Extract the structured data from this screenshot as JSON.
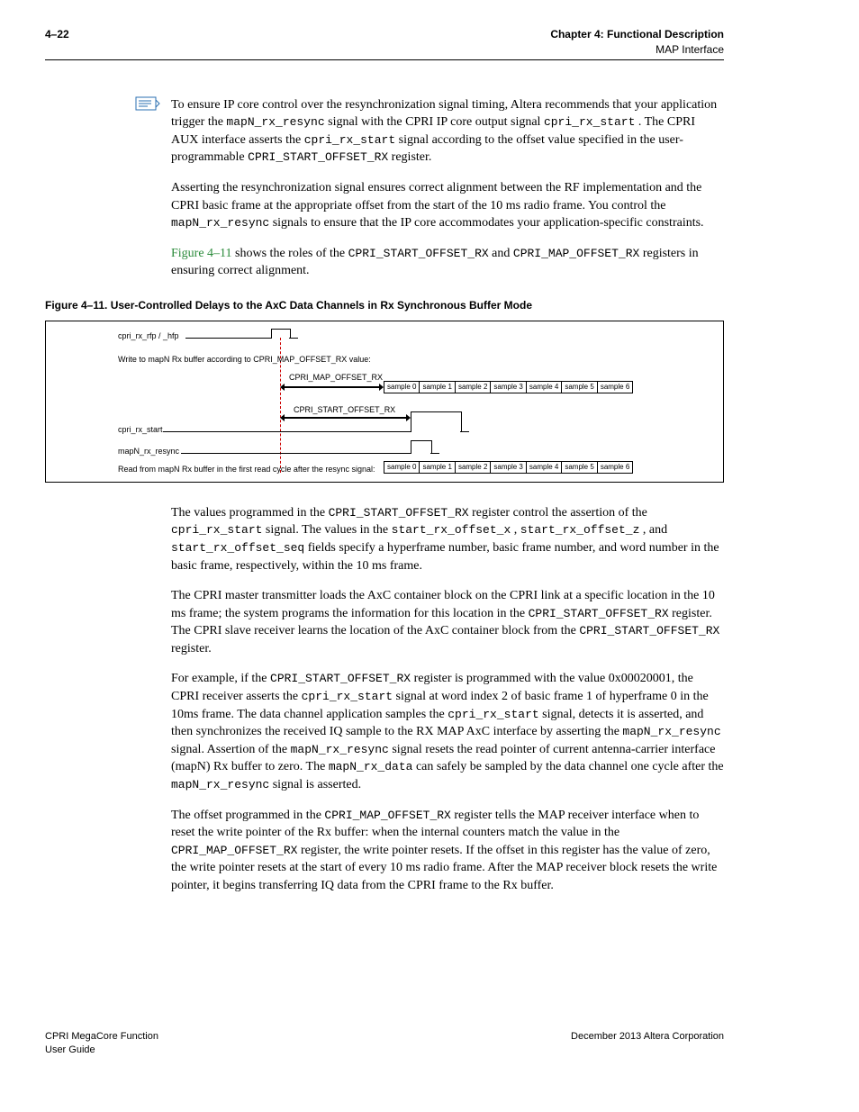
{
  "header": {
    "page": "4–22",
    "chapter": "Chapter 4: Functional Description",
    "section": "MAP Interface"
  },
  "note": {
    "text": "To ensure IP core control over the resynchronization signal timing, Altera recommends that your application trigger the ",
    "mono1": "mapN_rx_resync",
    "text2": " signal with the CPRI IP core output signal ",
    "mono2": "cpri_rx_start",
    "text3": ". The CPRI AUX interface asserts the ",
    "mono3": "cpri_rx_start",
    "text4": " signal according to the offset value specified in the user-programmable ",
    "mono4": "CPRI_START_OFFSET_RX",
    "text5": " register."
  },
  "p2": {
    "t1": "Asserting the resynchronization signal ensures correct alignment between the RF implementation and the CPRI basic frame at the appropriate offset from the start of the 10 ms radio frame. You control the ",
    "m1": "mapN_rx_resync",
    "t2": " signals to ensure that the IP core accommodates your application-specific constraints."
  },
  "p3": {
    "link": "Figure 4–11",
    "t1": " shows the roles of the ",
    "m1": "CPRI_START_OFFSET_RX",
    "t2": " and ",
    "m2": "CPRI_MAP_OFFSET_RX",
    "t3": " registers in ensuring correct alignment."
  },
  "caption": "Figure 4–11.  User-Controlled Delays to the AxC Data Channels in Rx Synchronous Buffer Mode",
  "fig": {
    "l1": "cpri_rx_rfp / _hfp",
    "l2": "Write to mapN Rx buffer according to CPRI_MAP_OFFSET_RX value:",
    "l3": "CPRI_MAP_OFFSET_RX",
    "l4": "CPRI_START_OFFSET_RX",
    "l5": "cpri_rx_start",
    "l6": "mapN_rx_resync",
    "l7": "Read from mapN Rx buffer in the first read cycle after the resync signal:",
    "s0": "sample 0",
    "s1": "sample 1",
    "s2": "sample 2",
    "s3": "sample 3",
    "s4": "sample 4",
    "s5": "sample 5",
    "s6": "sample 6"
  },
  "p4": {
    "t1": "The values programmed in the ",
    "m1": "CPRI_START_OFFSET_RX",
    "t2": " register control the assertion of the ",
    "m2": "cpri_rx_start",
    "t3": " signal. The values in the ",
    "m3": "start_rx_offset_x",
    "t4": ", ",
    "m4": "start_rx_offset_z",
    "t5": ", and ",
    "m5": "start_rx_offset_seq",
    "t6": " fields specify a hyperframe number, basic frame number, and word number in the basic frame, respectively, within the 10 ms frame."
  },
  "p5": {
    "t1": "The CPRI master transmitter loads the AxC container block on the CPRI link at a specific location in the 10 ms frame; the system programs the information for this location in the ",
    "m1": "CPRI_START_OFFSET_RX",
    "t2": " register. The CPRI slave receiver learns the location of the AxC container block from the ",
    "m2": "CPRI_START_OFFSET_RX",
    "t3": " register."
  },
  "p6": {
    "t1": "For example, if the ",
    "m1": "CPRI_START_OFFSET_RX",
    "t2": " register is programmed with the value 0x00020001, the CPRI receiver asserts the ",
    "m2": "cpri_rx_start",
    "t3": " signal at word index 2 of basic frame 1 of hyperframe 0 in the 10ms frame. The data channel application samples the ",
    "m3": "cpri_rx_start",
    "t4": " signal, detects it is asserted, and then synchronizes the received IQ sample to the RX MAP AxC interface by asserting the ",
    "m4": "mapN_rx_resync",
    "t5": " signal. Assertion of the ",
    "m5": "mapN_rx_resync",
    "t6": " signal resets the read pointer of current antenna-carrier interface (mapN) Rx buffer to zero. The ",
    "m6": "mapN_rx_data",
    "t7": " can safely be sampled by the data channel one cycle after the ",
    "m7": "mapN_rx_resync",
    "t8": " signal is asserted."
  },
  "p7": {
    "t1": "The offset programmed in the ",
    "m1": "CPRI_MAP_OFFSET_RX",
    "t2": " register tells the MAP receiver interface when to reset the write pointer of the Rx buffer: when the internal counters match the value in the ",
    "m2": "CPRI_MAP_OFFSET_RX",
    "t3": " register, the write pointer resets. If the offset in this register has the value of zero, the write pointer resets at the start of every 10 ms radio frame. After the MAP receiver block resets the write pointer, it begins transferring IQ data from the CPRI frame to the Rx buffer."
  },
  "footer": {
    "left1": "CPRI MegaCore Function",
    "left2": "User Guide",
    "right": "December 2013   Altera Corporation"
  }
}
